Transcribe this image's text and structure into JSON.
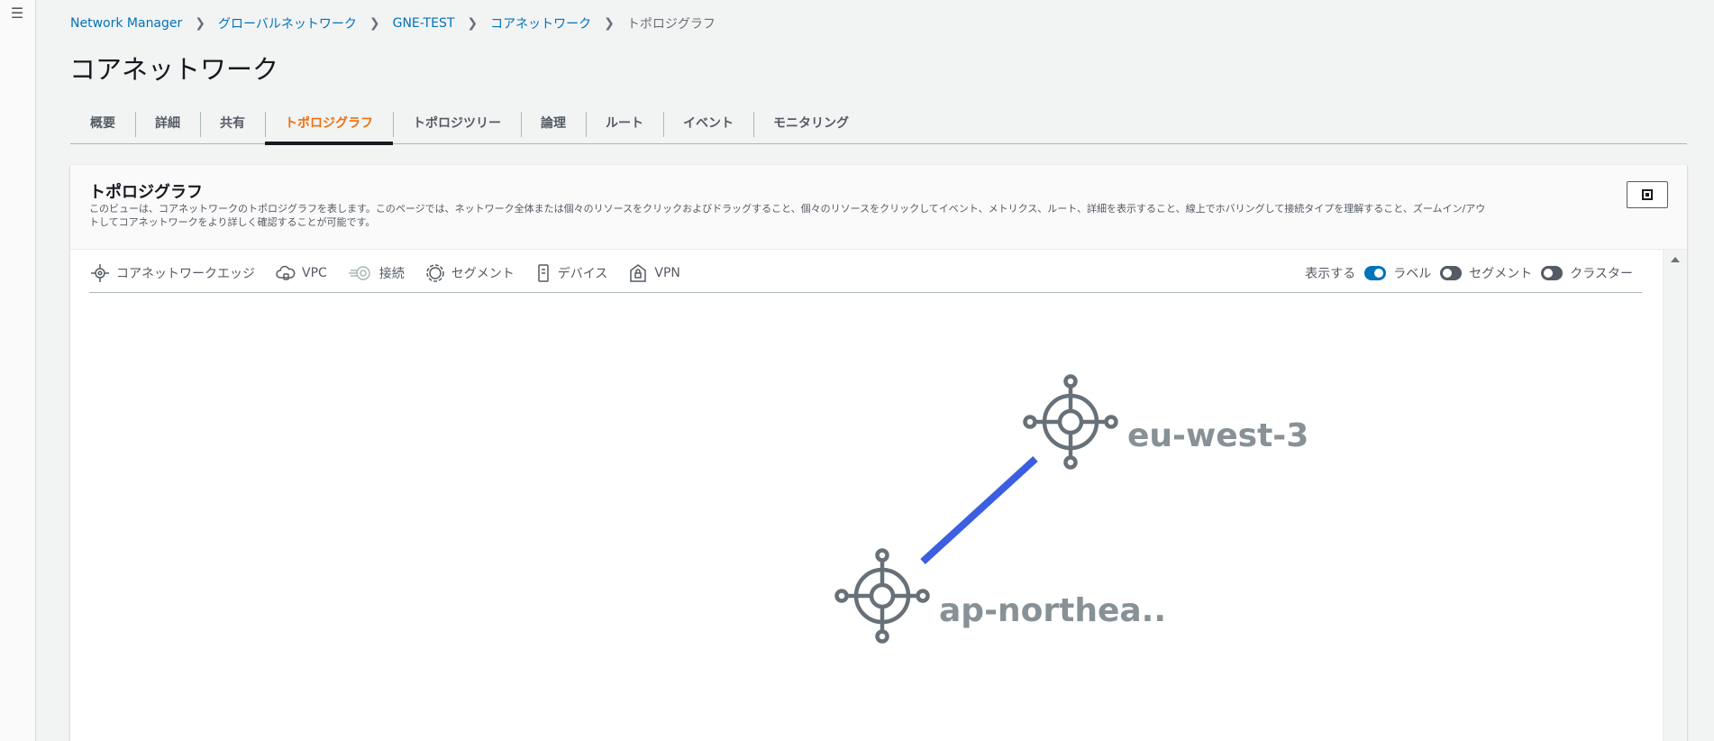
{
  "nav": {
    "menu_icon": "hamburger-icon"
  },
  "breadcrumb": {
    "items": [
      "Network Manager",
      "グローバルネットワーク",
      "GNE-TEST",
      "コアネットワーク"
    ],
    "current": "トポロジグラフ"
  },
  "page": {
    "title": "コアネットワーク"
  },
  "tabs": [
    {
      "label": "概要"
    },
    {
      "label": "詳細"
    },
    {
      "label": "共有"
    },
    {
      "label": "トポロジグラフ",
      "active": true
    },
    {
      "label": "トポロジツリー"
    },
    {
      "label": "論理"
    },
    {
      "label": "ルート"
    },
    {
      "label": "イベント"
    },
    {
      "label": "モニタリング"
    }
  ],
  "panel": {
    "title": "トポロジグラフ",
    "description": "このビューは、コアネットワークのトポロジグラフを表します。このページでは、ネットワーク全体または個々のリソースをクリックおよびドラッグすること、個々のリソースをクリックしてイベント、メトリクス、ルート、詳細を表示すること、線上でホバリングして接続タイプを理解すること、ズームイン/アウトしてコアネットワークをより詳しく確認することが可能です。",
    "fullscreen_icon": "fullscreen-icon"
  },
  "legend": [
    {
      "label": "コアネットワークエッジ",
      "icon": "core-network-edge-icon"
    },
    {
      "label": "VPC",
      "icon": "vpc-icon"
    },
    {
      "label": "接続",
      "icon": "connect-icon"
    },
    {
      "label": "セグメント",
      "icon": "segment-icon"
    },
    {
      "label": "デバイス",
      "icon": "device-icon"
    },
    {
      "label": "VPN",
      "icon": "vpn-icon"
    }
  ],
  "display": {
    "label": "表示する",
    "toggles": [
      {
        "label": "ラベル",
        "on": true
      },
      {
        "label": "セグメント",
        "on": false
      },
      {
        "label": "クラスター",
        "on": false
      }
    ]
  },
  "graph": {
    "link_color": "#3b5fe0",
    "node_color": "#687078",
    "nodes": [
      {
        "id": "eu",
        "label": "eu-west-3"
      },
      {
        "id": "ap",
        "label": "ap-northea.."
      }
    ]
  },
  "colors": {
    "link": "#0073bb",
    "active_tab": "#ec7211"
  }
}
